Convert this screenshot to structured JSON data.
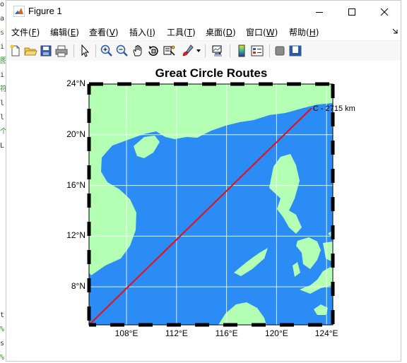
{
  "window": {
    "title": "Figure 1"
  },
  "menu": [
    {
      "label": "文件(",
      "key": "F",
      "tail": ")"
    },
    {
      "label": "编辑(",
      "key": "E",
      "tail": ")"
    },
    {
      "label": "查看(",
      "key": "V",
      "tail": ")"
    },
    {
      "label": "插入(",
      "key": "I",
      "tail": ")"
    },
    {
      "label": "工具(",
      "key": "T",
      "tail": ")"
    },
    {
      "label": "桌面(",
      "key": "D",
      "tail": ")"
    },
    {
      "label": "窗口(",
      "key": "W",
      "tail": ")"
    },
    {
      "label": "帮助(",
      "key": "H",
      "tail": ")"
    }
  ],
  "background_strip": [
    "o",
    "a",
    "s",
    "i",
    "图",
    "i",
    "符",
    "l",
    "l",
    "个",
    "L",
    "t",
    "%",
    "s",
    "%"
  ],
  "toolbar_icons": [
    "new-figure-icon",
    "open-file-icon",
    "save-icon",
    "print-icon",
    "pointer-icon",
    "zoom-in-icon",
    "zoom-out-icon",
    "pan-icon",
    "rotate-icon",
    "data-cursor-icon",
    "brush-icon",
    "link-icon",
    "colorbar-icon",
    "legend-icon",
    "hide-plot-tools-icon",
    "show-plot-tools-icon"
  ],
  "chart_data": {
    "type": "line",
    "title": "Great Circle Routes",
    "xlabel": "",
    "ylabel": "",
    "xlim": [
      105,
      124.5
    ],
    "ylim": [
      5,
      24
    ],
    "x_ticks": [
      108,
      112,
      116,
      120,
      124
    ],
    "x_tick_labels": [
      "108°E",
      "112°E",
      "116°E",
      "120°E",
      "124°E"
    ],
    "y_ticks": [
      8,
      12,
      16,
      20,
      24
    ],
    "y_tick_labels": [
      "8°N",
      "12°N",
      "16°N",
      "20°N",
      "24°N"
    ],
    "grid": true,
    "colors": {
      "ocean": "#2b8cf5",
      "land": "#b3ffb3",
      "route": "#e0141e",
      "grid": "#ffffff"
    },
    "series": [
      {
        "x": [
          105,
          122.8
        ],
        "y": [
          5,
          22.1
        ]
      }
    ],
    "annotations": [
      {
        "text": "C - 2715 km",
        "x": 122.8,
        "y": 22.1
      }
    ]
  }
}
